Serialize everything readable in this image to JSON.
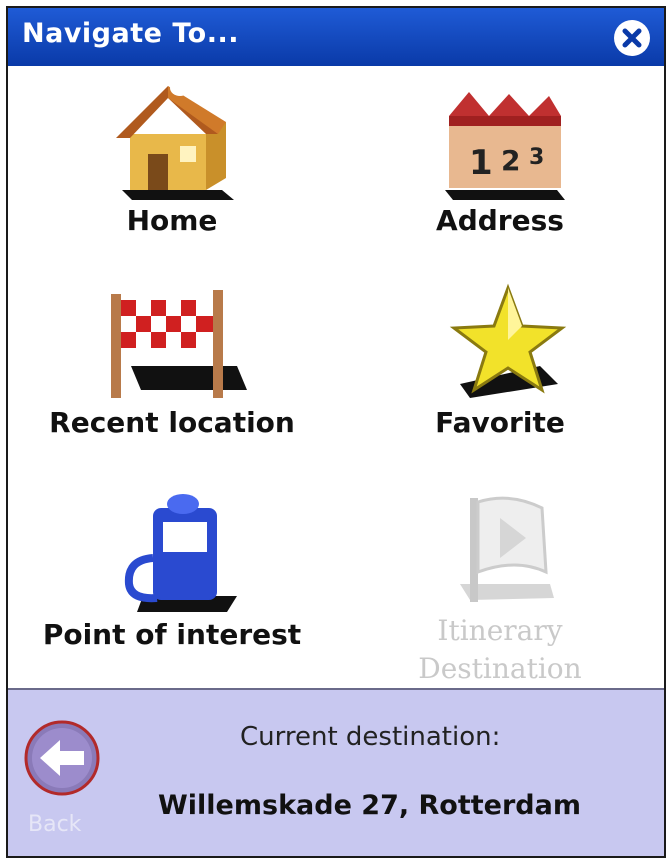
{
  "window": {
    "title": "Navigate To...",
    "close_icon": "close-icon"
  },
  "menu": {
    "home": {
      "label": "Home",
      "icon": "house-icon"
    },
    "address": {
      "label": "Address",
      "icon": "numbered-buildings-icon"
    },
    "recent": {
      "label": "Recent location",
      "icon": "checkered-flag-icon"
    },
    "favorite": {
      "label": "Favorite",
      "icon": "star-icon"
    },
    "poi": {
      "label": "Point of interest",
      "icon": "fuel-pump-icon"
    },
    "itinerary": {
      "label_line1": "Itinerary",
      "label_line2": "Destination",
      "icon": "itinerary-flag-icon",
      "enabled": false
    }
  },
  "footer": {
    "back_label": "Back",
    "current_label": "Current destination:",
    "current_value": "Willemskade 27, Rotterdam"
  },
  "colors": {
    "titlebar": "#0a3aa8",
    "footer": "#c8c8f0"
  }
}
